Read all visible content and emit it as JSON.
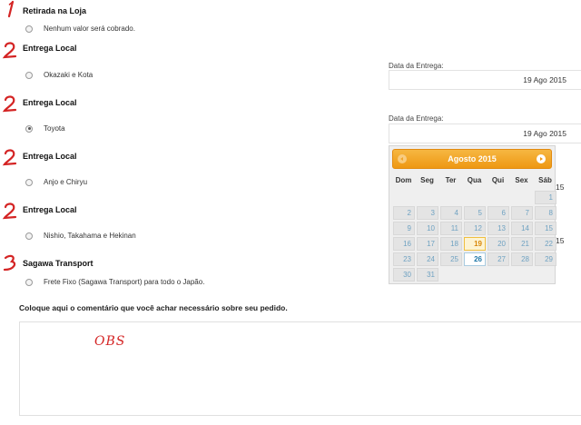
{
  "shipping": {
    "sections": [
      {
        "marker": "1",
        "heading": "Retirada na Loja",
        "option": "Nenhum valor será cobrado.",
        "checked": false
      },
      {
        "marker": "2",
        "heading": "Entrega Local",
        "option": "Okazaki e Kota",
        "checked": false,
        "date_label": "Data da Entrega:",
        "date_value": "19 Ago 2015"
      },
      {
        "marker": "2",
        "heading": "Entrega Local",
        "option": "Toyota",
        "checked": true,
        "date_label": "Data da Entrega:",
        "date_value": "19 Ago 2015"
      },
      {
        "marker": "2",
        "heading": "Entrega Local",
        "option": "Anjo e Chiryu",
        "checked": false,
        "date_peek": "15"
      },
      {
        "marker": "2",
        "heading": "Entrega Local",
        "option": "Nishio, Takahama e Hekinan",
        "checked": false,
        "date_peek": "15"
      },
      {
        "marker": "3",
        "heading": "Sagawa Transport",
        "option": "Frete Fixo (Sagawa Transport) para todo o Japão.",
        "checked": false
      }
    ]
  },
  "comment": {
    "label": "Coloque aqui o comentário que você achar necessário sobre seu pedido.",
    "annotation": "OBS"
  },
  "calendar": {
    "title": "Agosto 2015",
    "weekdays": [
      "Dom",
      "Seg",
      "Ter",
      "Qua",
      "Qui",
      "Sex",
      "Sáb"
    ],
    "days": [
      "1",
      "2",
      "3",
      "4",
      "5",
      "6",
      "7",
      "8",
      "9",
      "10",
      "11",
      "12",
      "13",
      "14",
      "15",
      "16",
      "17",
      "18",
      "19",
      "20",
      "21",
      "22",
      "23",
      "24",
      "25",
      "26",
      "27",
      "28",
      "29",
      "30",
      "31"
    ],
    "first_weekday_index": 6,
    "today": "19",
    "selected": "26",
    "colors": {
      "header": "#f2a62a",
      "day_text": "#6fa2c2",
      "today": "#d8870a",
      "selected": "#1f77a8"
    }
  },
  "colors": {
    "marker": "#d42424"
  }
}
